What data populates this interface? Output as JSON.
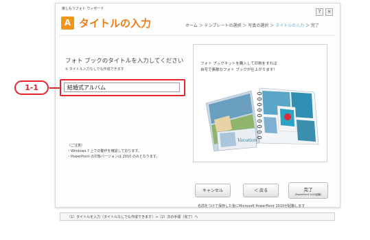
{
  "window": {
    "app_title": "楽しもうフォト ウィザード",
    "help_label": "?",
    "close_label": "×"
  },
  "header": {
    "icon_letter": "A",
    "page_title": "タイトルの入力",
    "breadcrumb": {
      "steps_before": "ホーム ＞ テンプレートの選択 ＞ 写真の選択 ＞ ",
      "active": "タイトルの入力",
      "steps_after": " ＞ 完了"
    }
  },
  "main": {
    "prompt": "フォト ブックのタイトルを入力してください",
    "note": "※ タイトル入力なしでも作成できます",
    "title_value": "結婚式アルバム",
    "callout_label": "1-1",
    "caution_heading": "〈ご注意〉",
    "caution_lines": [
      "・Windows 7 上での動作を確認しております。",
      "・PowerPoint の対象バージョンは 2010 のみとなります。"
    ]
  },
  "preview": {
    "lines": [
      "フォト ブックキットを購入して印刷をすれば",
      "自宅で素敵なフォト ブックが仕上がります！"
    ],
    "book_cover_text": "Vacation"
  },
  "buttons": {
    "cancel": "キャンセル",
    "back": "＜ 戻る",
    "finish": "完了",
    "finish_sub": "(PowerPoint 2010起動)"
  },
  "footer": {
    "finish_note": "名前をつけて保存した後にMicrosoft PowerPoint 2010が起動します",
    "status": "（1）タイトルを入力（タイトルなしでも作成できます）→（2）次の手順（完了）へ"
  },
  "colors": {
    "accent_orange": "#ec7d14",
    "callout_red": "#e3252b",
    "breadcrumb_active": "#69b3d8"
  }
}
